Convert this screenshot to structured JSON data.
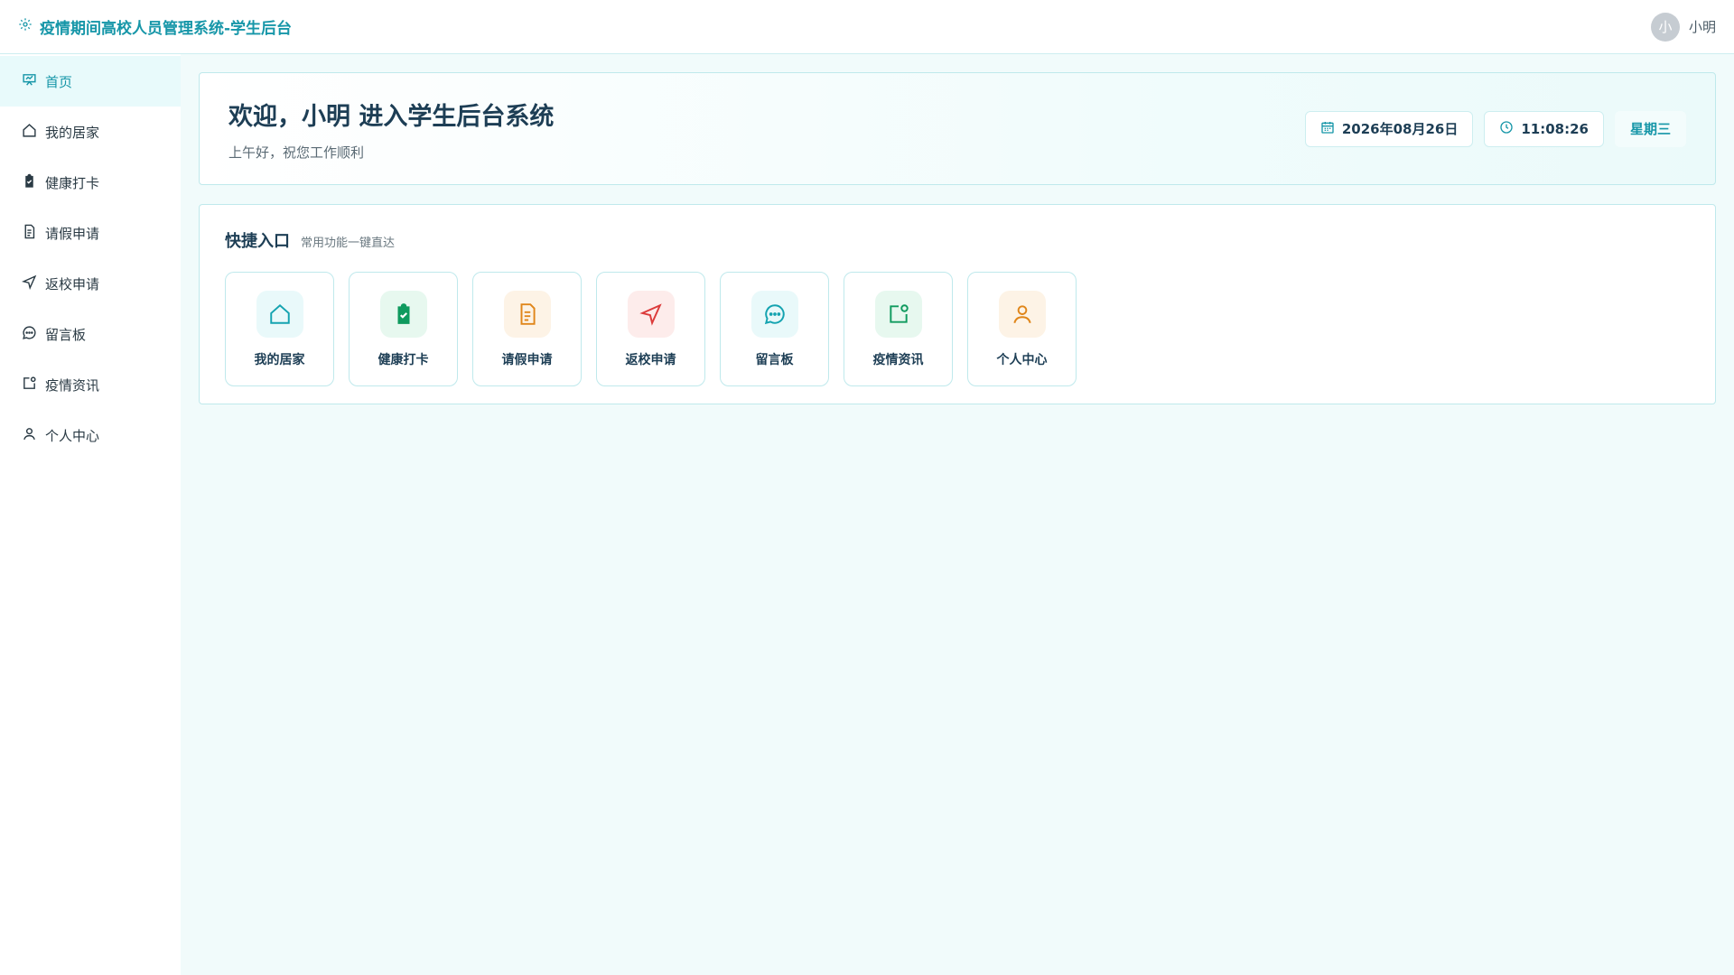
{
  "header": {
    "title": "疫情期间高校人员管理系统-学生后台",
    "user_initial": "小",
    "user_name": "小明"
  },
  "sidebar": {
    "items": [
      {
        "label": "首页",
        "icon": "dashboard-icon",
        "active": true
      },
      {
        "label": "我的居家",
        "icon": "home-icon"
      },
      {
        "label": "健康打卡",
        "icon": "clipboard-check-icon"
      },
      {
        "label": "请假申请",
        "icon": "document-icon"
      },
      {
        "label": "返校申请",
        "icon": "send-icon"
      },
      {
        "label": "留言板",
        "icon": "chat-icon"
      },
      {
        "label": "疫情资讯",
        "icon": "news-icon"
      },
      {
        "label": "个人中心",
        "icon": "user-icon"
      }
    ]
  },
  "welcome": {
    "title": "欢迎，小明 进入学生后台系统",
    "subtitle": "上午好，祝您工作顺利",
    "date": "2026年08月26日",
    "time": "11:08:26",
    "weekday": "星期三"
  },
  "quick": {
    "title": "快捷入口",
    "subtitle": "常用功能一键直达",
    "cards": [
      {
        "label": "我的居家",
        "icon": "home-icon",
        "color": "#14a3b0",
        "bg": "#e9f9fa"
      },
      {
        "label": "健康打卡",
        "icon": "clipboard-check-icon",
        "color": "#0f9a5e",
        "bg": "#e7f8ef"
      },
      {
        "label": "请假申请",
        "icon": "document-icon",
        "color": "#e0861a",
        "bg": "#fdf3e6"
      },
      {
        "label": "返校申请",
        "icon": "send-icon",
        "color": "#dc3b3b",
        "bg": "#fdeceb"
      },
      {
        "label": "留言板",
        "icon": "chat-icon",
        "color": "#14a3b0",
        "bg": "#e9f9fa"
      },
      {
        "label": "疫情资讯",
        "icon": "news-icon",
        "color": "#0f9a5e",
        "bg": "#e7f8ef"
      },
      {
        "label": "个人中心",
        "icon": "user-icon",
        "color": "#e0861a",
        "bg": "#fdf3e6"
      }
    ]
  },
  "colors": {
    "accent": "#1696a8",
    "page_bg": "#f1fbfb",
    "border": "#bfe9ec"
  }
}
